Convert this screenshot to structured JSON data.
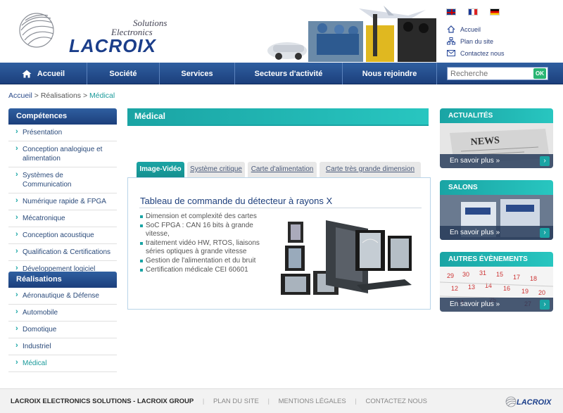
{
  "header": {
    "logo": {
      "solutions": "Solutions",
      "electronics": "Electronics",
      "lacroix": "LACROIX"
    },
    "utility_links": [
      {
        "icon": "home-icon",
        "label": "Accueil"
      },
      {
        "icon": "sitemap-icon",
        "label": "Plan du site"
      },
      {
        "icon": "mail-icon",
        "label": "Contactez nous"
      }
    ],
    "flags": [
      "uk-flag-icon",
      "fr-flag-icon",
      "de-flag-icon"
    ]
  },
  "nav": {
    "items": [
      "Accueil",
      "Société",
      "Services",
      "Secteurs d'activité",
      "Nous rejoindre"
    ],
    "search": {
      "placeholder": "Recherche",
      "button": "OK"
    }
  },
  "breadcrumb": {
    "items": [
      "Accueil",
      "Réalisations"
    ],
    "separator": ">",
    "current": "Médical"
  },
  "sidebar": {
    "competences": {
      "title": "Compétences",
      "items": [
        "Présentation",
        "Conception analogique et alimentation",
        "Systèmes de Communication",
        "Numérique rapide & FPGA",
        "Mécatronique",
        "Conception acoustique",
        "Qualification & Certifications",
        "Développement logiciel"
      ]
    },
    "realisations": {
      "title": "Réalisations",
      "items": [
        "Aéronautique & Défense",
        "Automobile",
        "Domotique",
        "Industriel",
        "Médical"
      ],
      "active": "Médical"
    }
  },
  "main": {
    "title": "Médical",
    "tabs": [
      "Image-Vidéo",
      "Système critique",
      "Carte d'alimentation",
      "Carte très grande dimension"
    ],
    "active_tab": "Image-Vidéo",
    "panel": {
      "title": "Tableau de commande du détecteur à rayons X",
      "bullets": [
        "Dimension et complexité des cartes",
        "SoC FPGA : CAN 16 bits à grande vitesse,",
        "traitement vidéo HW, RTOS, liaisons séries optiques à grande vitesse",
        "Gestion de l'alimentation et du bruit",
        "Certification médicale CEI 60601"
      ]
    }
  },
  "right": {
    "boxes": [
      {
        "title": "ACTUALITÉS",
        "more": "En savoir plus »"
      },
      {
        "title": "SALONS",
        "more": "En savoir plus »"
      },
      {
        "title": "AUTRES ÉVÈNEMENTS",
        "more": "En savoir plus »"
      }
    ]
  },
  "footer": {
    "brand": "LACROIX ELECTRONICS SOLUTIONS - LACROIX GROUP",
    "links": [
      "PLAN DU SITE",
      "MENTIONS LÉGALES",
      "CONTACTEZ NOUS"
    ],
    "logo": "LACROIX"
  },
  "colors": {
    "nav_blue": "#1c3f7c",
    "teal_accent": "#1aa4a4"
  }
}
